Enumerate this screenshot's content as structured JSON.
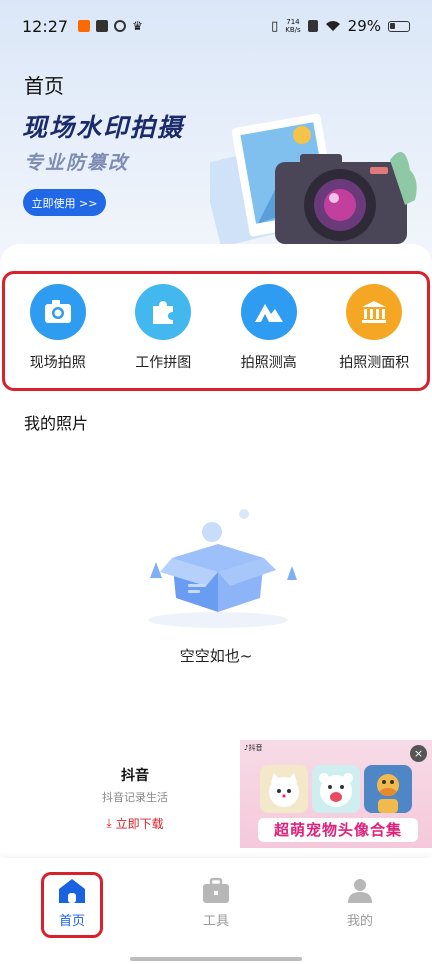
{
  "status_bar": {
    "time": "12:27",
    "net_speed_value": "714",
    "net_speed_unit": "KB/s",
    "battery": "29%",
    "icons": [
      "taobao-icon",
      "box-icon",
      "sync-icon",
      "crown-icon",
      "vibrate-icon",
      "sim-icon",
      "wifi-icon",
      "battery-icon"
    ]
  },
  "header": {
    "title": "首页",
    "banner_title": "现场水印拍摄",
    "banner_subtitle": "专业防篡改",
    "cta_label": "立即使用 >>"
  },
  "features": [
    {
      "label": "现场拍照",
      "icon": "camera-icon",
      "color": "#2e9cf0"
    },
    {
      "label": "工作拼图",
      "icon": "puzzle-icon",
      "color": "#42b8ee"
    },
    {
      "label": "拍照测高",
      "icon": "mountain-icon",
      "color": "#2e9cf0"
    },
    {
      "label": "拍照测面积",
      "icon": "bank-icon",
      "color": "#f5a623"
    }
  ],
  "photos": {
    "section_title": "我的照片",
    "empty_text": "空空如也~"
  },
  "ad": {
    "app_name": "抖音",
    "app_desc": "抖音记录生活",
    "download_label": "立即下载",
    "source_label": "抖音",
    "headline": "超萌宠物头像合集",
    "close_label": "×"
  },
  "bottom_nav": [
    {
      "label": "首页",
      "icon": "home-icon",
      "active": true
    },
    {
      "label": "工具",
      "icon": "toolbox-icon",
      "active": false
    },
    {
      "label": "我的",
      "icon": "user-icon",
      "active": false
    }
  ],
  "colors": {
    "accent": "#2168e6",
    "highlight_red": "#d8212a",
    "nav_active": "#1a63e0",
    "nav_inactive": "#9a9a9a"
  }
}
